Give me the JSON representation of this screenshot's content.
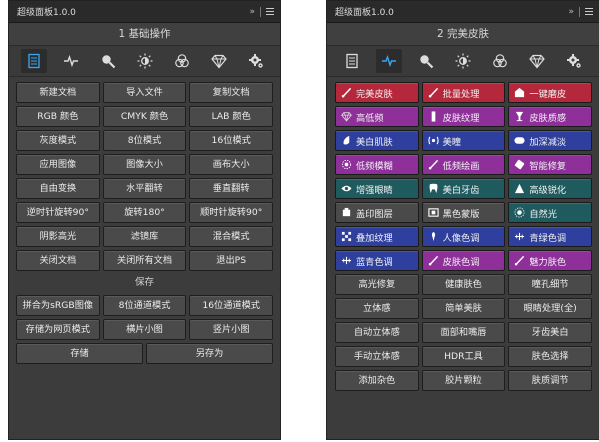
{
  "colors": {
    "red": "#b5283c",
    "purple": "#8e2f9a",
    "blue": "#2f3f9e",
    "teal": "#1f5a5e",
    "gray_btn": "#4a4a4a"
  },
  "left": {
    "title": "超级面板1.0.0",
    "section_title": "1 基础操作",
    "tools": [
      "document-icon",
      "heal-icon",
      "magnifier-icon",
      "brightness-icon",
      "rgb-circles-icon",
      "diamond-icon",
      "gear-icon"
    ],
    "rows": [
      [
        "新建文档",
        "导入文件",
        "复制文档"
      ],
      [
        "RGB 颜色",
        "CMYK 颜色",
        "LAB 颜色"
      ],
      [
        "灰度模式",
        "8位模式",
        "16位模式"
      ],
      [
        "应用图像",
        "图像大小",
        "画布大小"
      ],
      [
        "自由变换",
        "水平翻转",
        "垂直翻转"
      ],
      [
        "逆时针旋转90°",
        "旋转180°",
        "顺时针旋转90°"
      ],
      [
        "阴影高光",
        "滤镜库",
        "混合模式"
      ],
      [
        "关闭文档",
        "关闭所有文档",
        "退出PS"
      ]
    ],
    "save_label": "保存",
    "save_rows": [
      [
        "拼合为sRGB图像",
        "8位通道模式",
        "16位通道模式"
      ],
      [
        "存储为网页模式",
        "横片小图",
        "竖片小图"
      ],
      [
        "存储",
        "另存为"
      ]
    ]
  },
  "right": {
    "title": "超级面板1.0.0",
    "section_title": "2 完美皮肤",
    "tools": [
      "document-icon",
      "heal-icon",
      "magnifier-icon",
      "brightness-icon",
      "rgb-circles-icon",
      "diamond-icon",
      "gear-icon"
    ],
    "color_rows": [
      [
        {
          "label": "完美皮肤",
          "color": "red",
          "icon": "brush-icon"
        },
        {
          "label": "批量处理",
          "color": "red",
          "icon": "brush-icon"
        },
        {
          "label": "一键磨皮",
          "color": "red",
          "icon": "house-icon"
        }
      ],
      [
        {
          "label": "高低频",
          "color": "purple",
          "icon": "diamond-icon"
        },
        {
          "label": "皮肤纹理",
          "color": "purple",
          "icon": "bar-icon"
        },
        {
          "label": "皮肤质感",
          "color": "purple",
          "icon": "goblet-icon"
        }
      ],
      [
        {
          "label": "美白肌肤",
          "color": "blue",
          "icon": "drop-icon"
        },
        {
          "label": "美瞳",
          "color": "blue",
          "icon": "eye-bracket-icon"
        },
        {
          "label": "加深减淡",
          "color": "blue",
          "icon": "pill-icon"
        }
      ],
      [
        {
          "label": "低频模糊",
          "color": "purple",
          "icon": "blur-icon"
        },
        {
          "label": "低频绘画",
          "color": "purple",
          "icon": "brush-icon"
        },
        {
          "label": "智能修复",
          "color": "purple",
          "icon": "patch-icon"
        }
      ],
      [
        {
          "label": "增强眼睛",
          "color": "teal",
          "icon": "eye-icon"
        },
        {
          "label": "美白牙齿",
          "color": "teal",
          "icon": "tooth-icon"
        },
        {
          "label": "高级锐化",
          "color": "teal",
          "icon": "triangle-icon"
        }
      ],
      [
        {
          "label": "盖印图层",
          "color": "gray",
          "icon": "stamp-icon"
        },
        {
          "label": "黑色蒙版",
          "color": "gray",
          "icon": "mask-icon"
        },
        {
          "label": "自然光",
          "color": "teal",
          "icon": "sun-icon"
        }
      ],
      [
        {
          "label": "叠加纹理",
          "color": "blue",
          "icon": "texture-icon"
        },
        {
          "label": "人像色调",
          "color": "blue",
          "icon": "figure-icon"
        },
        {
          "label": "青绿色调",
          "color": "blue",
          "icon": "cross-icon"
        }
      ],
      [
        {
          "label": "蓝青色调",
          "color": "blue",
          "icon": "cross-icon"
        },
        {
          "label": "皮肤色调",
          "color": "purple",
          "icon": "brush-icon"
        },
        {
          "label": "魅力肤色",
          "color": "purple",
          "icon": "brush-icon"
        }
      ]
    ],
    "gray_rows": [
      [
        "高光修复",
        "健康肤色",
        "瞳孔细节"
      ],
      [
        "立体感",
        "简单美肤",
        "眼睛处理(全)"
      ],
      [
        "自动立体感",
        "面部和嘴唇",
        "牙齿美白"
      ],
      [
        "手动立体感",
        "HDR工具",
        "肤色选择"
      ],
      [
        "添加杂色",
        "胶片颗粒",
        "肤质调节"
      ]
    ]
  }
}
